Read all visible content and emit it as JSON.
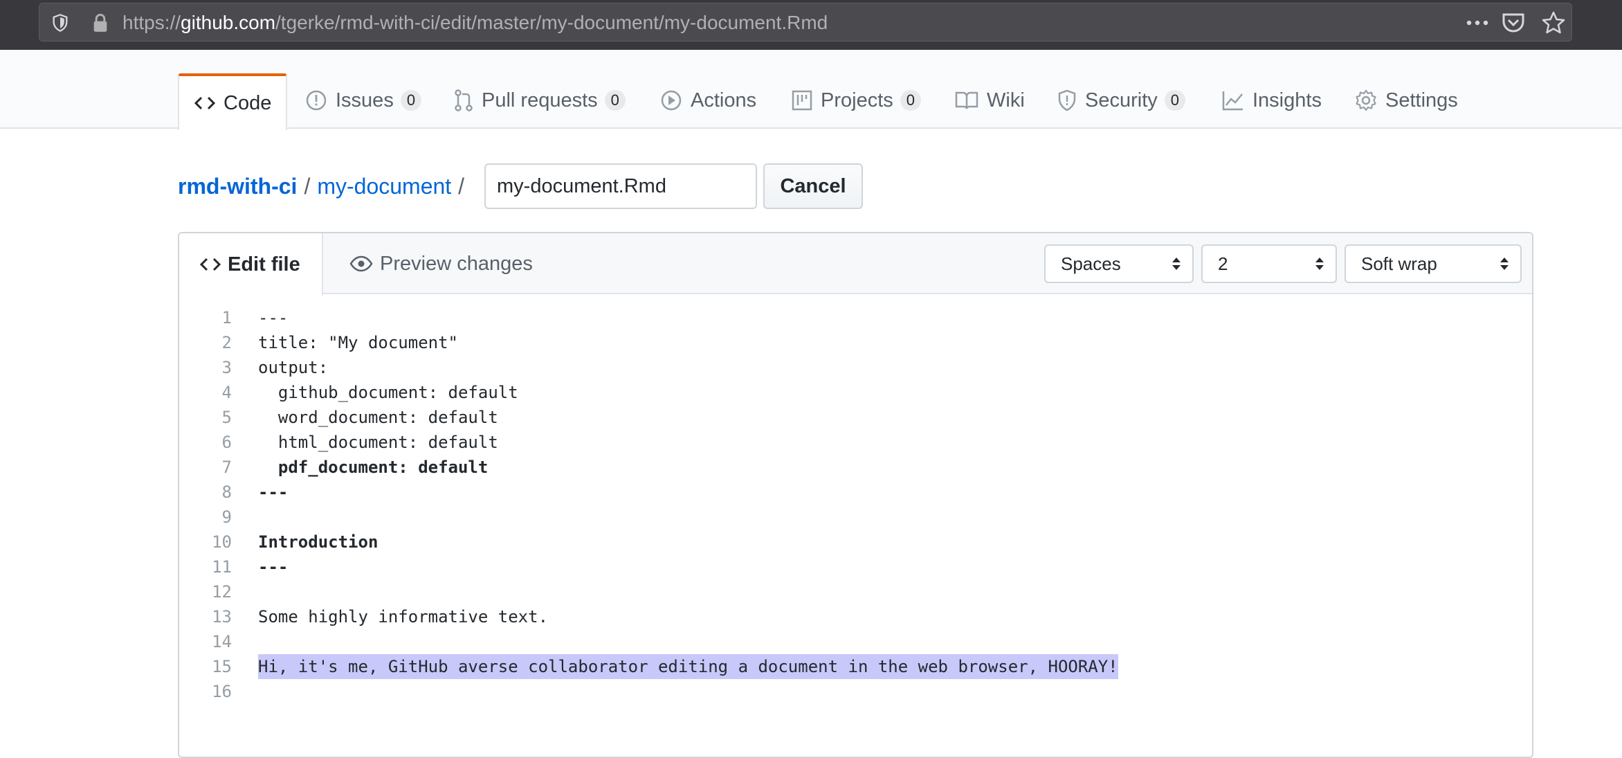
{
  "browser": {
    "url_prefix": "https://",
    "url_host": "github.com",
    "url_path": "/tgerke/rmd-with-ci/edit/master/my-document/my-document.Rmd",
    "icons": [
      "shield-icon",
      "lock-icon",
      "more-icon",
      "pocket-icon",
      "star-icon"
    ]
  },
  "nav": {
    "tabs": [
      {
        "label": "Code",
        "icon": "code-icon",
        "active": true
      },
      {
        "label": "Issues",
        "count": "0",
        "icon": "issue-icon"
      },
      {
        "label": "Pull requests",
        "count": "0",
        "icon": "pull-request-icon"
      },
      {
        "label": "Actions",
        "icon": "play-icon"
      },
      {
        "label": "Projects",
        "count": "0",
        "icon": "project-icon"
      },
      {
        "label": "Wiki",
        "icon": "book-icon"
      },
      {
        "label": "Security",
        "count": "0",
        "icon": "shield-icon"
      },
      {
        "label": "Insights",
        "icon": "graph-icon"
      },
      {
        "label": "Settings",
        "icon": "gear-icon"
      }
    ]
  },
  "breadcrumb": {
    "repo": "rmd-with-ci",
    "folder": "my-document",
    "separator": "/",
    "filename": "my-document.Rmd",
    "cancel_label": "Cancel"
  },
  "editor": {
    "tab_edit": "Edit file",
    "tab_preview": "Preview changes",
    "indent_mode": "Spaces",
    "indent_size": "2",
    "wrap_mode": "Soft wrap",
    "lines": [
      {
        "n": "1",
        "text": "---"
      },
      {
        "n": "2",
        "text": "title: \"My document\""
      },
      {
        "n": "3",
        "text": "output:"
      },
      {
        "n": "4",
        "text": "  github_document: default"
      },
      {
        "n": "5",
        "text": "  word_document: default"
      },
      {
        "n": "6",
        "text": "  html_document: default"
      },
      {
        "n": "7",
        "text": "  pdf_document: default",
        "bold": true
      },
      {
        "n": "8",
        "text": "---",
        "bold": true
      },
      {
        "n": "9",
        "text": ""
      },
      {
        "n": "10",
        "text": "Introduction",
        "bold": true
      },
      {
        "n": "11",
        "text": "---",
        "bold": true
      },
      {
        "n": "12",
        "text": ""
      },
      {
        "n": "13",
        "text": "Some highly informative text."
      },
      {
        "n": "14",
        "text": ""
      },
      {
        "n": "15",
        "text": "Hi, it's me, GitHub averse collaborator editing a document in the web browser, HOORAY!",
        "selected": true
      },
      {
        "n": "16",
        "text": ""
      }
    ],
    "selection_color": "#c8c8fa"
  },
  "colors": {
    "link": "#0366d6",
    "active_tab_accent": "#e36209",
    "browser_chrome": "#38383d"
  }
}
